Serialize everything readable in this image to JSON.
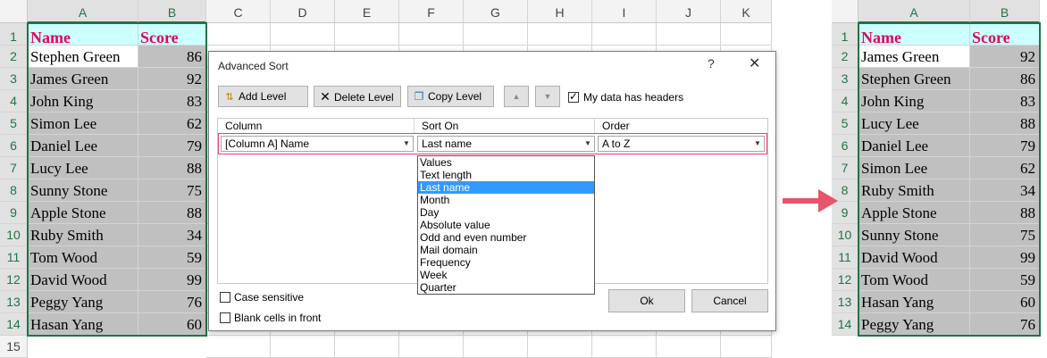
{
  "left_sheet": {
    "columns": [
      "A",
      "B",
      "C",
      "D",
      "E",
      "F",
      "G",
      "H",
      "I",
      "J",
      "K"
    ],
    "row_numbers": [
      "1",
      "2",
      "3",
      "4",
      "5",
      "6",
      "7",
      "8",
      "9",
      "10",
      "11",
      "12",
      "13",
      "14",
      "15"
    ],
    "header": {
      "name": "Name",
      "score": "Score"
    },
    "rows": [
      {
        "name": "Stephen Green",
        "score": "86"
      },
      {
        "name": "James Green",
        "score": "92"
      },
      {
        "name": "John King",
        "score": "83"
      },
      {
        "name": "Simon Lee",
        "score": "62"
      },
      {
        "name": "Daniel Lee",
        "score": "79"
      },
      {
        "name": "Lucy Lee",
        "score": "88"
      },
      {
        "name": "Sunny Stone",
        "score": "75"
      },
      {
        "name": "Apple Stone",
        "score": "88"
      },
      {
        "name": "Ruby Smith",
        "score": "34"
      },
      {
        "name": "Tom Wood",
        "score": "59"
      },
      {
        "name": "David Wood",
        "score": "99"
      },
      {
        "name": "Peggy Yang",
        "score": "76"
      },
      {
        "name": "Hasan Yang",
        "score": "60"
      }
    ]
  },
  "right_sheet": {
    "columns": [
      "A",
      "B"
    ],
    "row_numbers": [
      "1",
      "2",
      "3",
      "4",
      "5",
      "6",
      "7",
      "8",
      "9",
      "10",
      "11",
      "12",
      "13",
      "14"
    ],
    "header": {
      "name": "Name",
      "score": "Score"
    },
    "rows": [
      {
        "name": "James Green",
        "score": "92"
      },
      {
        "name": "Stephen Green",
        "score": "86"
      },
      {
        "name": "John King",
        "score": "83"
      },
      {
        "name": "Lucy Lee",
        "score": "88"
      },
      {
        "name": "Daniel Lee",
        "score": "79"
      },
      {
        "name": "Simon Lee",
        "score": "62"
      },
      {
        "name": "Ruby Smith",
        "score": "34"
      },
      {
        "name": "Apple Stone",
        "score": "88"
      },
      {
        "name": "Sunny Stone",
        "score": "75"
      },
      {
        "name": "David Wood",
        "score": "99"
      },
      {
        "name": "Tom Wood",
        "score": "59"
      },
      {
        "name": "Hasan Yang",
        "score": "60"
      },
      {
        "name": "Peggy Yang",
        "score": "76"
      }
    ]
  },
  "dialog": {
    "title": "Advanced Sort",
    "help": "?",
    "close": "✕",
    "add_level": "Add Level",
    "delete_level": "Delete Level",
    "copy_level": "Copy Level",
    "up": "▲",
    "down": "▼",
    "headers_checkbox": "My data has headers",
    "col_header": "Column",
    "sorton_header": "Sort On",
    "order_header": "Order",
    "column_value": "[Column A] Name",
    "sorton_value": "Last name",
    "order_value": "A to Z",
    "case_sensitive": "Case sensitive",
    "blank_cells": "Blank cells in front",
    "ok": "Ok",
    "cancel": "Cancel",
    "sort_options": [
      "Values",
      "Text length",
      "Last name",
      "Month",
      "Day",
      "Absolute value",
      "Odd and even number",
      "Mail domain",
      "Frequency",
      "Week",
      "Quarter"
    ],
    "selected_option": "Last name"
  },
  "colors": {
    "header_text": "#e4005c",
    "header_fill": "#ccffff",
    "data_fill": "#c0c0c0",
    "selection": "#217346",
    "arrow": "#e8546a"
  }
}
